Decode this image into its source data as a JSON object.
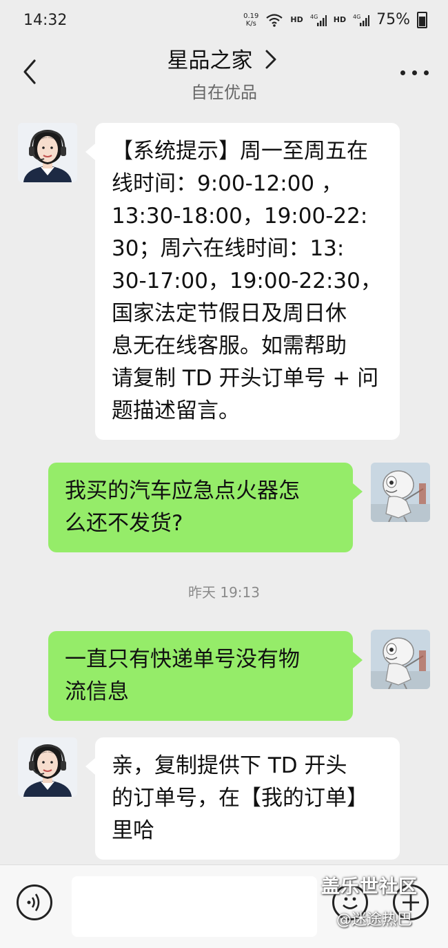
{
  "status_bar": {
    "time": "14:32",
    "net_speed_value": "0.19",
    "net_speed_unit": "K/s",
    "hd1": "HD",
    "hd2": "HD",
    "battery": "75%"
  },
  "header": {
    "title": "星品之家",
    "subtitle": "自在优品"
  },
  "messages": [
    {
      "side": "left",
      "sender": "agent",
      "lines": [
        "【系统提示】周一至周五在",
        "线时间：9:00-12:00 ，",
        "13:30-18:00，19:00-22:",
        "30；周六在线时间：13:",
        "30-17:00，19:00-22:30，",
        "国家法定节假日及周日休",
        "息无在线客服。如需帮助",
        "请复制 TD 开头订单号 + 问",
        "题描述留言。"
      ]
    },
    {
      "side": "right",
      "sender": "user",
      "lines": [
        "我买的汽车应急点火器怎",
        "么还不发货?"
      ]
    },
    {
      "side": "right",
      "sender": "user",
      "lines": [
        "一直只有快递单号没有物",
        "流信息"
      ]
    },
    {
      "side": "left",
      "sender": "agent",
      "lines": [
        "亲，复制提供下 TD 开头",
        "的订单号，在【我的订单】",
        "里哈"
      ]
    }
  ],
  "timestamp": "昨天 19:13",
  "watermark": {
    "line1": "盖乐世社区",
    "line2": "@迷途热巴"
  },
  "colors": {
    "background": "#ededed",
    "user_bubble": "#95ec69",
    "agent_bubble": "#ffffff"
  }
}
